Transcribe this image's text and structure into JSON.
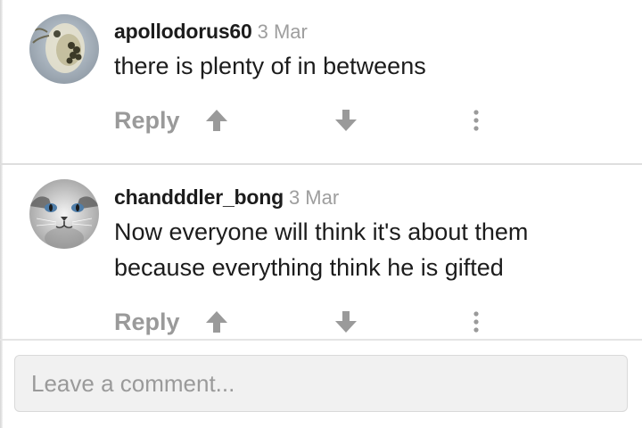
{
  "comments": [
    {
      "username": "apollodorus60",
      "date": "3 Mar",
      "text": "there is plenty of in betweens",
      "reply_label": "Reply",
      "avatar": "daphnia-microscope-photo"
    },
    {
      "username": "chandddler_bong",
      "date": "3 Mar",
      "text": "Now everyone will think it's about them because everything think he is gifted",
      "reply_label": "Reply",
      "avatar": "grey-cat-face-photo"
    }
  ],
  "composer": {
    "placeholder": "Leave a comment..."
  },
  "icons": {
    "upvote": "arrow-up-icon",
    "downvote": "arrow-down-icon",
    "more": "vertical-dots-icon"
  },
  "colors": {
    "username": "#1c1c1c",
    "meta": "#9e9e9e",
    "action": "#9a9a9a",
    "divider": "#dedede",
    "composer_bg": "#f1f1f1"
  }
}
